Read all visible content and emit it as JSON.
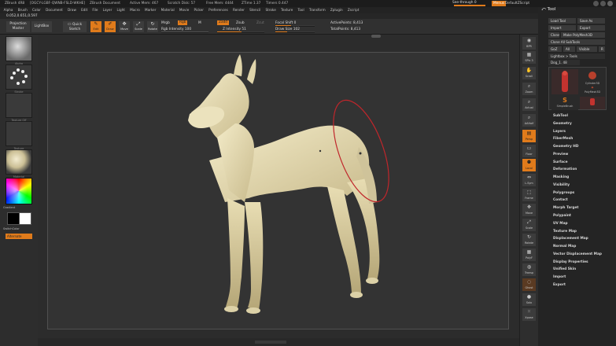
{
  "titlebar": {
    "app": "ZBrush 4R8",
    "stats": [
      "[OGCY-LGBF-QWNB-FSLD-WKHE]",
      "ZBrush Document",
      "Active Mem: 467",
      "Scratch Disk: 57",
      "Free Mem: 4444",
      "ZTime 1.37",
      "Timers 0.447"
    ],
    "see_through": "See-through  0",
    "menus": "Menus",
    "default_zscript": "DefaultZScript"
  },
  "menubar": [
    "Alpha",
    "Brush",
    "Color",
    "Document",
    "Draw",
    "Edit",
    "File",
    "Layer",
    "Light",
    "Macro",
    "Marker",
    "Material",
    "Movie",
    "Picker",
    "Preferences",
    "Render",
    "Stencil",
    "Stroke",
    "Texture",
    "Tool",
    "Transform",
    "Zplugin",
    "Zscript"
  ],
  "coords": "0.052,0.651,0.597",
  "toolbar": {
    "projection_master": "Projection Master",
    "lightbox": "LightBox",
    "quick_sketch": "Quick Sketch",
    "edit": "Edit",
    "draw": "Draw",
    "move": "Move",
    "scale": "Scale",
    "rotate": "Rotate",
    "mrgb": "Mrgb",
    "rgb": "Rgb",
    "m": "M",
    "rgb_intensity": "Rgb Intensity 100",
    "rgb_intensity_value": 100,
    "zadd": "Zadd",
    "zsub": "Zsub",
    "zcut": "Zcut",
    "z_intensity": "Z Intensity 51",
    "z_intensity_value": 51,
    "focal_shift": "Focal Shift 0",
    "focal_shift_value": 0,
    "draw_size": "Draw Size 102",
    "draw_size_value": 102,
    "active_points": "ActivePoints: 8,413",
    "total_points": "TotalPoints: 8,413"
  },
  "left_shelf": {
    "slots": [
      "Alpha",
      "Stroke",
      "Texture Off",
      "Texture",
      "Material"
    ],
    "gradient": "Gradient",
    "switch_color": "SwitchColor",
    "alternate": "Alternate"
  },
  "right_shelf": [
    "BPR",
    "SPix 3",
    "Scroll",
    "Zoom",
    "Actual",
    "AAHalf",
    "Persp",
    "Floor",
    "Local",
    "L.Sym",
    "Frame",
    "Move",
    "Scale",
    "Rotate",
    "PolyF",
    "Transp",
    "Ghost",
    "Solo",
    "Xpose"
  ],
  "tray": {
    "title": "Tool",
    "load_tool": "Load Tool",
    "save_as": "Save As",
    "import": "Import",
    "export": "Export",
    "clone": "Clone",
    "make_polymesh": "Make PolyMesh3D",
    "goz": "GoZ",
    "all": "All",
    "visible": "Visible",
    "r": "R",
    "clone_all": "Clone All SubTools",
    "lightbox_tools": "Lightbox > Tools",
    "current_tool": "Dog_1. 48",
    "thumbs": [
      "Dog_1",
      "Cylinder3D",
      "PolyMesh3D",
      "SimpleBrush",
      "Dog_1"
    ],
    "menu": [
      "SubTool",
      "Geometry",
      "Layers",
      "FiberMesh",
      "Geometry HD",
      "Preview",
      "Surface",
      "Deformation",
      "Masking",
      "Visibility",
      "Polygroups",
      "Contact",
      "Morph Target",
      "Polypaint",
      "UV Map",
      "Texture Map",
      "Displacement Map",
      "Normal Map",
      "Vector Displacement Map",
      "Display Properties",
      "Unified Skin",
      "Import",
      "Export"
    ]
  },
  "colors": {
    "accent": "#e07b1b",
    "canvas": "#333333",
    "model": "#e9dfb8",
    "cursor_ring": "#c0262b"
  }
}
